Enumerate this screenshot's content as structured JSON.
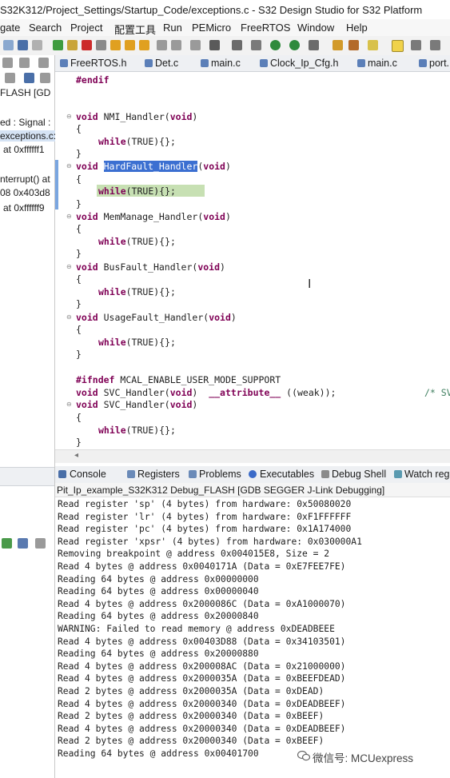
{
  "window": {
    "title": "S32K312/Project_Settings/Startup_Code/exceptions.c - S32 Design Studio for S32 Platform"
  },
  "menubar": [
    "gate",
    "Search",
    "Project",
    "配置工具",
    "Run",
    "PEMicro",
    "FreeRTOS",
    "Window",
    "Help"
  ],
  "left_panel": {
    "lines": [
      "FLASH [GD",
      "ed : Signal :",
      "exceptions.c:",
      "at 0xffffff1",
      "nterrupt() at",
      "08 0x403d8",
      "at 0xffffff9"
    ]
  },
  "editor": {
    "tabs": [
      "FreeRTOS.h",
      "Det.c",
      "main.c",
      "Clock_Ip_Cfg.h",
      "main.c",
      "port."
    ],
    "code": {
      "endif": "#endif",
      "nmi_sig": "void NMI_Handler(void)",
      "open_brace": "{",
      "close_brace": "}",
      "while_body": "while(TRUE){};",
      "hardfault_void": "void ",
      "hardfault_name": "HardFault_Handler",
      "hardfault_args": "(void)",
      "memmanage_sig": "void MemManage_Handler(void)",
      "busfault_sig": "void BusFault_Handler(void)",
      "usagefault_sig": "void UsageFault_Handler(void)",
      "ifndef_line": "#ifndef MCAL_ENABLE_USER_MODE_SUPPORT",
      "svc_weak_line": "void SVC_Handler(void)  __attribute__ ((weak));",
      "svc_comment": "/* SV",
      "svc_sig": "void SVC_Handler(void)"
    }
  },
  "console": {
    "tabs": [
      "Console",
      "Registers",
      "Problems",
      "Executables",
      "Debug Shell",
      "Watch reg"
    ],
    "session": "Pit_Ip_example_S32K312 Debug_FLASH [GDB SEGGER J-Link Debugging]",
    "lines": [
      "Read register 'sp' (4 bytes) from hardware: 0x50080020",
      "Read register 'lr' (4 bytes) from hardware: 0xF1FFFFFF",
      "Read register 'pc' (4 bytes) from hardware: 0x1A174000",
      "Read register 'xpsr' (4 bytes) from hardware: 0x030000A1",
      "Removing breakpoint @ address 0x004015E8, Size = 2",
      "Read 4 bytes @ address 0x0040171A (Data = 0xE7FEE7FE)",
      "Reading 64 bytes @ address 0x00000000",
      "Reading 64 bytes @ address 0x00000040",
      "Read 4 bytes @ address 0x2000086C (Data = 0xA1000070)",
      "Reading 64 bytes @ address 0x20000840",
      "WARNING: Failed to read memory @ address 0xDEADBEEE",
      "Read 4 bytes @ address 0x00403D88 (Data = 0x34103501)",
      "Reading 64 bytes @ address 0x20000880",
      "Read 4 bytes @ address 0x200008AC (Data = 0x21000000)",
      "Read 4 bytes @ address 0x2000035A (Data = 0xBEEFDEAD)",
      "Read 2 bytes @ address 0x2000035A (Data = 0xDEAD)",
      "Read 4 bytes @ address 0x20000340 (Data = 0xDEADBEEF)",
      "Read 2 bytes @ address 0x20000340 (Data = 0xBEEF)",
      "Read 4 bytes @ address 0x20000340 (Data = 0xDEADBEEF)",
      "Read 2 bytes @ address 0x20000340 (Data = 0xBEEF)",
      "Reading 64 bytes @ address 0x00401700"
    ]
  },
  "watermark": "微信号: MCUexpress",
  "icons": [
    "wechat-icon",
    "c-file-icon",
    "console-icon",
    "fold-icon"
  ],
  "colors": {
    "keyword": "#7f0055",
    "selection": "#3b6fd1",
    "current_line": "#c7e0b3"
  }
}
